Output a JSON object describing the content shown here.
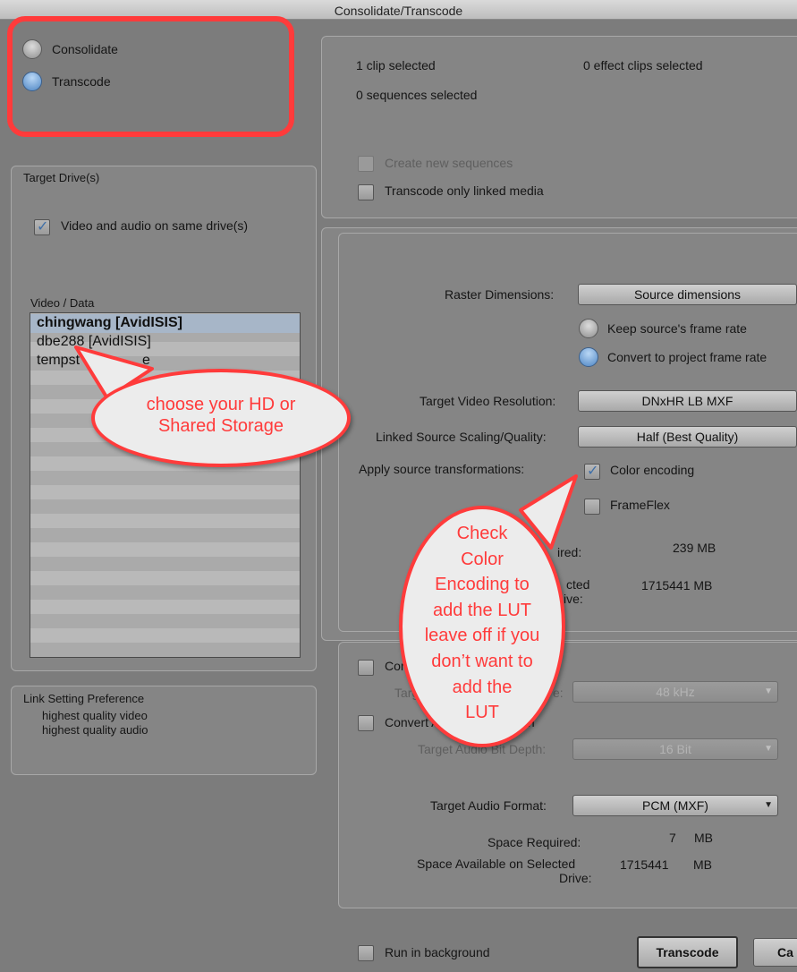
{
  "window": {
    "title": "Consolidate/Transcode"
  },
  "mode": {
    "consolidate_label": "Consolidate",
    "transcode_label": "Transcode",
    "selected": "Transcode"
  },
  "selection_info": {
    "clips": "1 clip selected",
    "effect_clips": "0 effect clips selected",
    "sequences": "0 sequences selected",
    "create_new_sequences": "Create new sequences",
    "transcode_only_linked": "Transcode only linked media"
  },
  "target_drives": {
    "title": "Target Drive(s)",
    "same_drive_label": "Video and audio on same drive(s)",
    "same_drive_checked": true,
    "list_label": "Video / Data",
    "drives": [
      "chingwang [AvidISIS]",
      "dbe288 [AvidISIS]",
      "tempst"
    ],
    "drive_tail": "e",
    "selected_index": 0
  },
  "link_pref": {
    "title": "Link Setting Preference",
    "video": "highest quality video",
    "audio": "highest quality audio"
  },
  "video": {
    "raster_label": "Raster Dimensions:",
    "raster_value": "Source dimensions",
    "keep_rate": "Keep source's frame rate",
    "convert_rate": "Convert to project frame rate",
    "frame_rate_selected": "convert",
    "resolution_label": "Target Video Resolution:",
    "resolution_value": "DNxHR LB  MXF",
    "scaling_label": "Linked Source Scaling/Quality:",
    "scaling_value": "Half (Best Quality)",
    "transform_label": "Apply source transformations:",
    "color_encoding": "Color encoding",
    "color_encoding_checked": true,
    "frameflex": "FrameFlex",
    "frameflex_checked": false,
    "space_required_frag": "ired:",
    "space_required": "239 MB",
    "space_avail_frag1": "cted",
    "space_avail_frag2": "ive:",
    "space_available": "1715441 MB"
  },
  "audio": {
    "convert_rate_frag": "Con",
    "target_rate_frag1": "Targ",
    "target_rate_frag2": "e:",
    "sample_rate_value": "48 kHz",
    "convert_bitdepth_frag": "Convert A",
    "convert_bitdepth_frag2": "th",
    "bitdepth_label": "Target Audio Bit Depth:",
    "bitdepth_value": "16 Bit",
    "format_label": "Target Audio Format:",
    "format_value": "PCM  (MXF)",
    "space_required_label": "Space Required:",
    "space_required_num": "7",
    "space_required_unit": "MB",
    "space_avail_label1": "Space Available on Selected",
    "space_avail_label2": "Drive:",
    "space_avail_num": "1715441",
    "space_avail_unit": "MB"
  },
  "footer": {
    "run_background": "Run in background",
    "transcode_button": "Transcode",
    "cancel_button": "Ca"
  },
  "annotations": {
    "bubble1_line1": "choose your HD or",
    "bubble1_line2": "Shared Storage",
    "bubble2_lines": [
      "Check",
      "Color",
      "Encoding to",
      "add the LUT",
      "leave off if you",
      "don’t want to",
      "add the",
      "LUT"
    ],
    "color": "#ff3b3b"
  }
}
